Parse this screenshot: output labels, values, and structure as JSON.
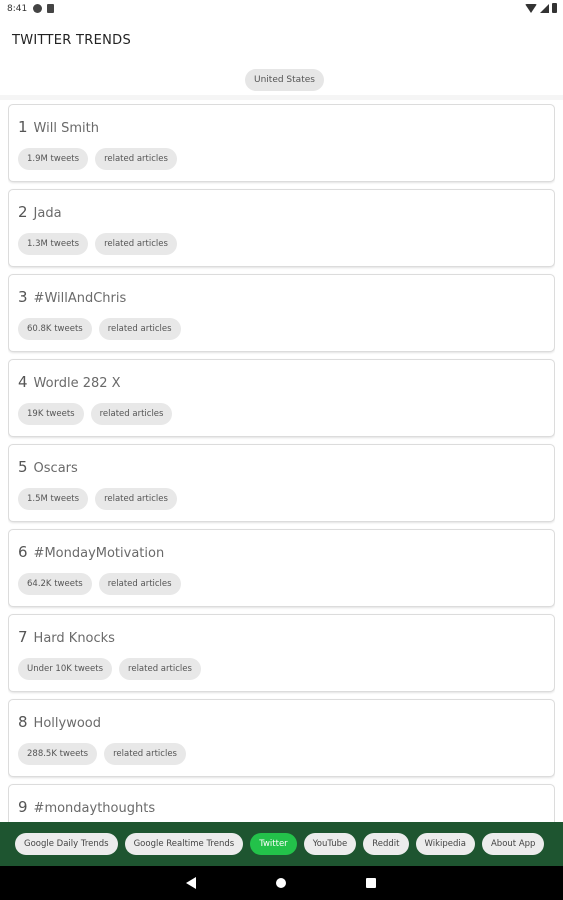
{
  "status_bar": {
    "time": "8:41",
    "icons": [
      "app-notification-icon",
      "sd-card-icon",
      "wifi-icon",
      "signal-icon",
      "battery-icon"
    ]
  },
  "app_bar": {
    "title": "TWITTER TRENDS",
    "country": "United States"
  },
  "trends": [
    {
      "rank": "1",
      "name": "Will Smith",
      "tweets": "1.9M tweets",
      "related": "related articles"
    },
    {
      "rank": "2",
      "name": "Jada",
      "tweets": "1.3M tweets",
      "related": "related articles"
    },
    {
      "rank": "3",
      "name": "#WillAndChris",
      "tweets": "60.8K tweets",
      "related": "related articles"
    },
    {
      "rank": "4",
      "name": "Wordle 282 X",
      "tweets": "19K tweets",
      "related": "related articles"
    },
    {
      "rank": "5",
      "name": "Oscars",
      "tweets": "1.5M tweets",
      "related": "related articles"
    },
    {
      "rank": "6",
      "name": "#MondayMotivation",
      "tweets": "64.2K tweets",
      "related": "related articles"
    },
    {
      "rank": "7",
      "name": "Hard Knocks",
      "tweets": "Under 10K tweets",
      "related": "related articles"
    },
    {
      "rank": "8",
      "name": "Hollywood",
      "tweets": "288.5K tweets",
      "related": "related articles"
    },
    {
      "rank": "9",
      "name": "#mondaythoughts",
      "tweets": "",
      "related": ""
    }
  ],
  "tabs": [
    {
      "label": "Google Daily Trends",
      "active": false
    },
    {
      "label": "Google Realtime Trends",
      "active": false
    },
    {
      "label": "Twitter",
      "active": true
    },
    {
      "label": "YouTube",
      "active": false
    },
    {
      "label": "Reddit",
      "active": false
    },
    {
      "label": "Wikipedia",
      "active": false
    },
    {
      "label": "About App",
      "active": false
    }
  ],
  "nav_bar": {
    "icons": [
      "back-icon",
      "home-icon",
      "recents-icon"
    ]
  },
  "colors": {
    "tab_bar_background": "#1e5530",
    "active_tab": "#23c24a",
    "chip_background": "#e8e8e8"
  }
}
